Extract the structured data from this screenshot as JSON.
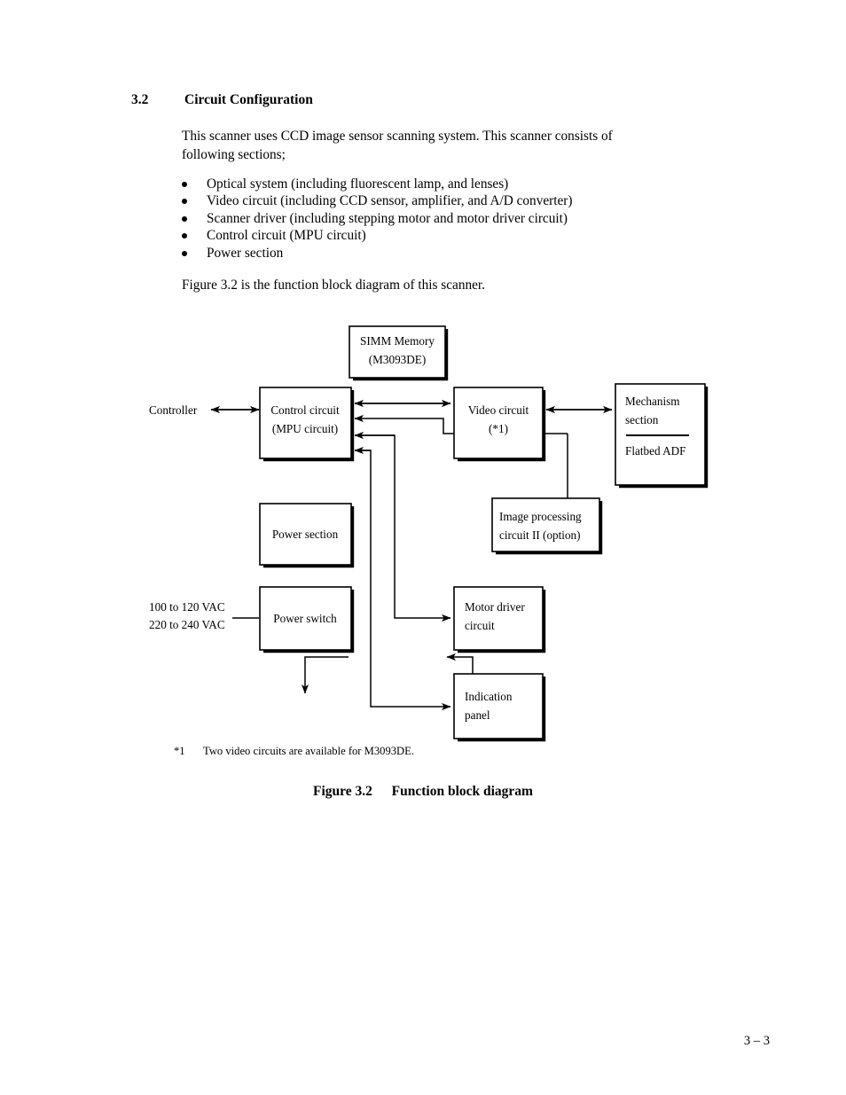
{
  "section": {
    "number": "3.2",
    "title": "Circuit Configuration"
  },
  "intro": {
    "line1": "This scanner uses CCD image sensor scanning system.  This scanner consists of",
    "line2": "following sections;"
  },
  "bullets": [
    "Optical system (including fluorescent lamp, and lenses)",
    "Video circuit (including CCD sensor, amplifier, and A/D converter)",
    "Scanner driver (including stepping motor and motor driver circuit)",
    "Control circuit (MPU circuit)",
    "Power section"
  ],
  "figure_intro": "Figure 3.2 is the function block diagram of this scanner.",
  "diagram": {
    "boxes": {
      "simm": {
        "line1": "SIMM Memory",
        "line2": "(M3093DE)"
      },
      "control": {
        "line1": "Control circuit",
        "line2": "(MPU circuit)"
      },
      "video": {
        "line1": "Video circuit",
        "line2": "(*1)"
      },
      "mechanism": {
        "line1": "Mechanism",
        "line2": "section",
        "line3": "Flatbed ADF"
      },
      "power_section": {
        "line1": "Power section"
      },
      "power_switch": {
        "line1": "Power switch"
      },
      "image_processing": {
        "line1": "Image processing",
        "line2": "circuit II (option)"
      },
      "motor_driver": {
        "line1": "Motor driver",
        "line2": "circuit"
      },
      "indication": {
        "line1": "Indication",
        "line2": "panel"
      }
    },
    "labels": {
      "controller": "Controller",
      "vac_1": "100 to 120 VAC",
      "vac_2": "220 to 240 VAC"
    }
  },
  "footnote": {
    "mark": "*1",
    "text": "Two video circuits are available for M3093DE."
  },
  "caption": {
    "number": "Figure 3.2",
    "title": "Function block diagram"
  },
  "page_number": "3 – 3"
}
